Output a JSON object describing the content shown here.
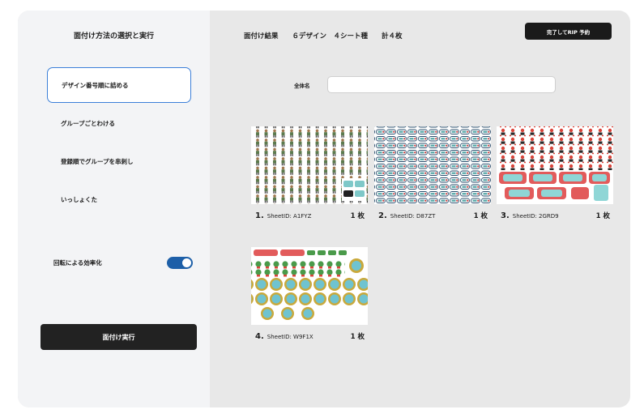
{
  "left_panel": {
    "title": "面付け方法の選択と実行",
    "options": [
      {
        "label": "デザイン番号順に詰める",
        "selected": true
      },
      {
        "label": "グループごとわける",
        "selected": false
      },
      {
        "label": "登録順でグループを串刺し",
        "selected": false
      },
      {
        "label": "いっしょくた",
        "selected": false
      }
    ],
    "rotation_toggle": {
      "label": "回転による効率化",
      "on": true
    },
    "run_button": "面付け実行"
  },
  "right_panel": {
    "summary": "面付け結果　　６デザイン　４シート種　　計４枚",
    "rip_button": "完了してRIP 予約",
    "name_field": {
      "label": "全体名",
      "value": "",
      "placeholder": ""
    },
    "sheets": [
      {
        "index": "1.",
        "sheet_id": "SheetID: A1FYZ",
        "count": "1 枚",
        "pattern": "figures-grid"
      },
      {
        "index": "2.",
        "sheet_id": "SheetID: D87ZT",
        "count": "1 枚",
        "pattern": "tags-grid"
      },
      {
        "index": "3.",
        "sheet_id": "SheetID: 2GRD9",
        "count": "1 枚",
        "pattern": "mixed-red"
      },
      {
        "index": "4.",
        "sheet_id": "SheetID: W9F1X",
        "count": "1 枚",
        "pattern": "badges"
      }
    ]
  },
  "colors": {
    "accent_blue": "#3b7fd8",
    "toggle_on": "#1d5fa8",
    "dark_button": "#222222",
    "panel_left": "#f3f4f6",
    "panel_right": "#e8e8e8"
  }
}
